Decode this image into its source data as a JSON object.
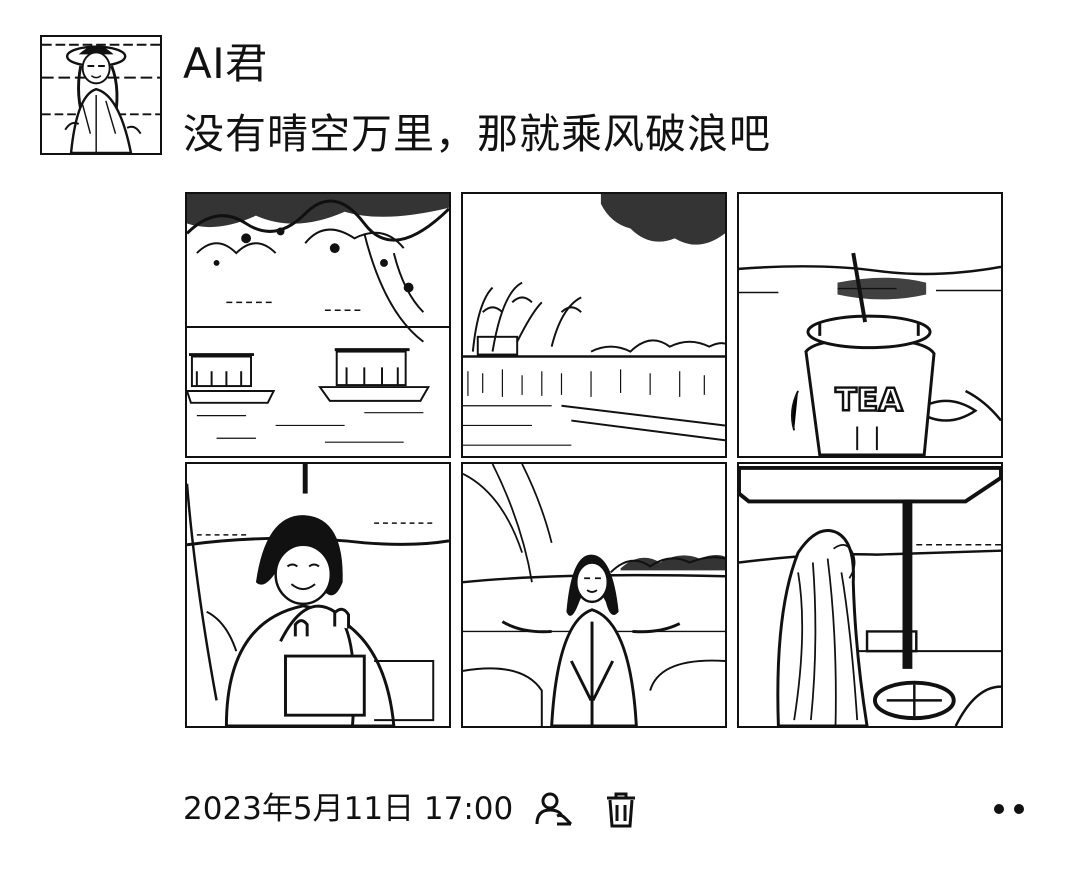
{
  "post": {
    "author": "AI君",
    "text": "没有晴空万里，那就乘风破浪吧",
    "timestamp": "2023年5月11日 17:00"
  },
  "photos": [
    {
      "name": "photo-lake-boats"
    },
    {
      "name": "photo-lakeshore-trees"
    },
    {
      "name": "photo-tea-cup",
      "label": "TEA"
    },
    {
      "name": "photo-woman-smiling"
    },
    {
      "name": "photo-woman-boat"
    },
    {
      "name": "photo-woman-canopy"
    }
  ],
  "icons": {
    "visibility": "person-icon",
    "delete": "trash-icon",
    "more": "more-icon"
  }
}
